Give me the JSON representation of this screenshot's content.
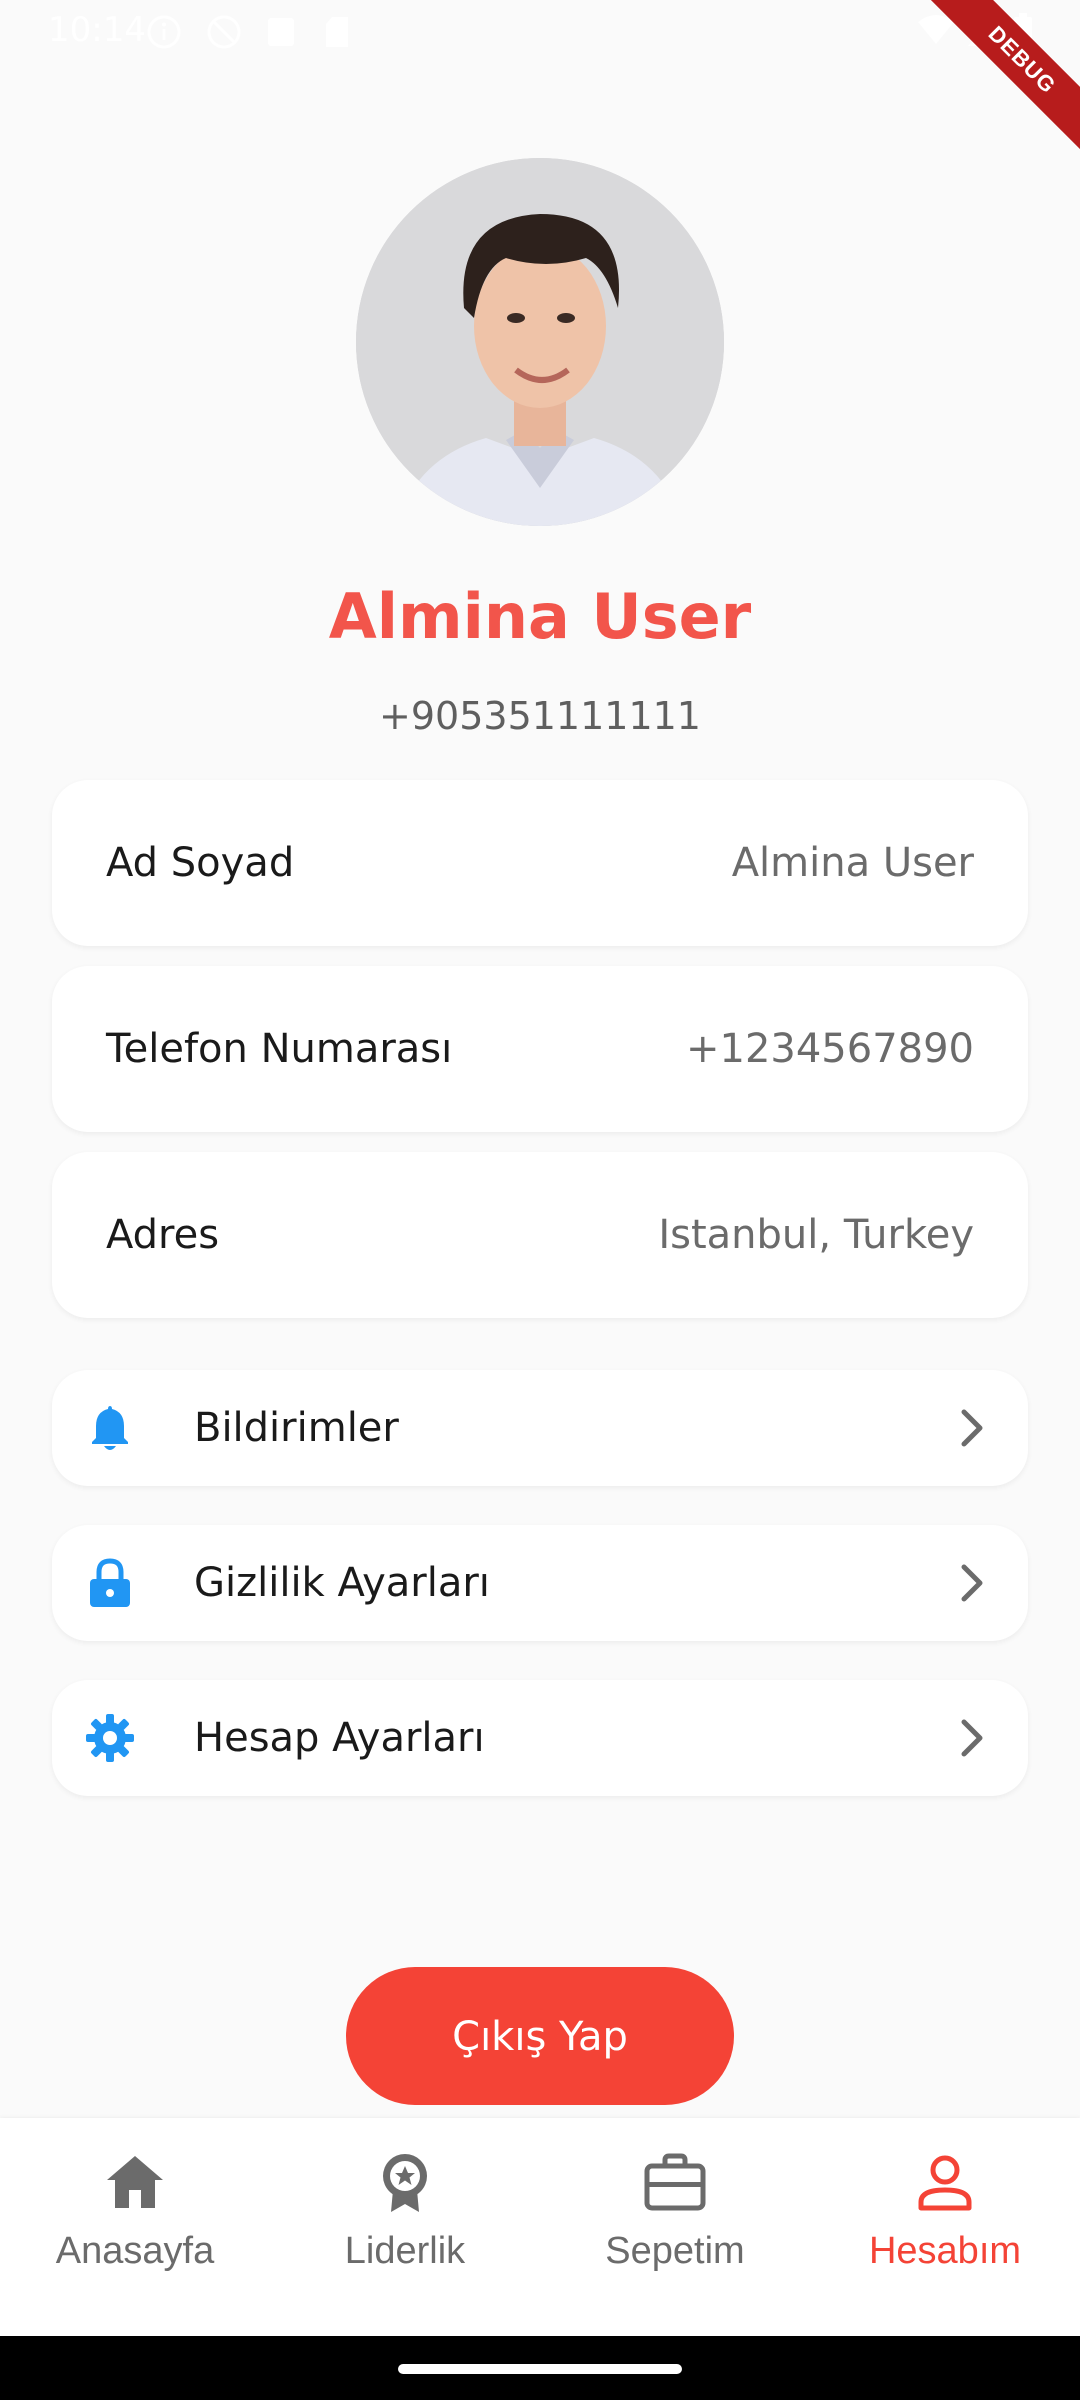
{
  "status_bar": {
    "time": "10:14"
  },
  "debug_banner": "DEBUG",
  "profile": {
    "name": "Almina User",
    "phone": "+905351111111"
  },
  "info_cards": [
    {
      "label": "Ad Soyad",
      "value": "Almina User"
    },
    {
      "label": "Telefon Numarası",
      "value": "+1234567890"
    },
    {
      "label": "Adres",
      "value": "Istanbul, Turkey"
    }
  ],
  "menu": [
    {
      "label": "Bildirimler",
      "icon": "bell-icon"
    },
    {
      "label": "Gizlilik Ayarları",
      "icon": "lock-icon"
    },
    {
      "label": "Hesap Ayarları",
      "icon": "gear-icon"
    }
  ],
  "logout_label": "Çıkış Yap",
  "bottom_nav": [
    {
      "label": "Anasayfa",
      "icon": "home-icon",
      "active": false
    },
    {
      "label": "Liderlik",
      "icon": "award-icon",
      "active": false
    },
    {
      "label": "Sepetim",
      "icon": "briefcase-icon",
      "active": false
    },
    {
      "label": "Hesabım",
      "icon": "person-icon",
      "active": true
    }
  ],
  "colors": {
    "accent": "#f44336",
    "name_color": "#f2554b",
    "icon_blue": "#2196f3",
    "background": "#fafafa"
  }
}
